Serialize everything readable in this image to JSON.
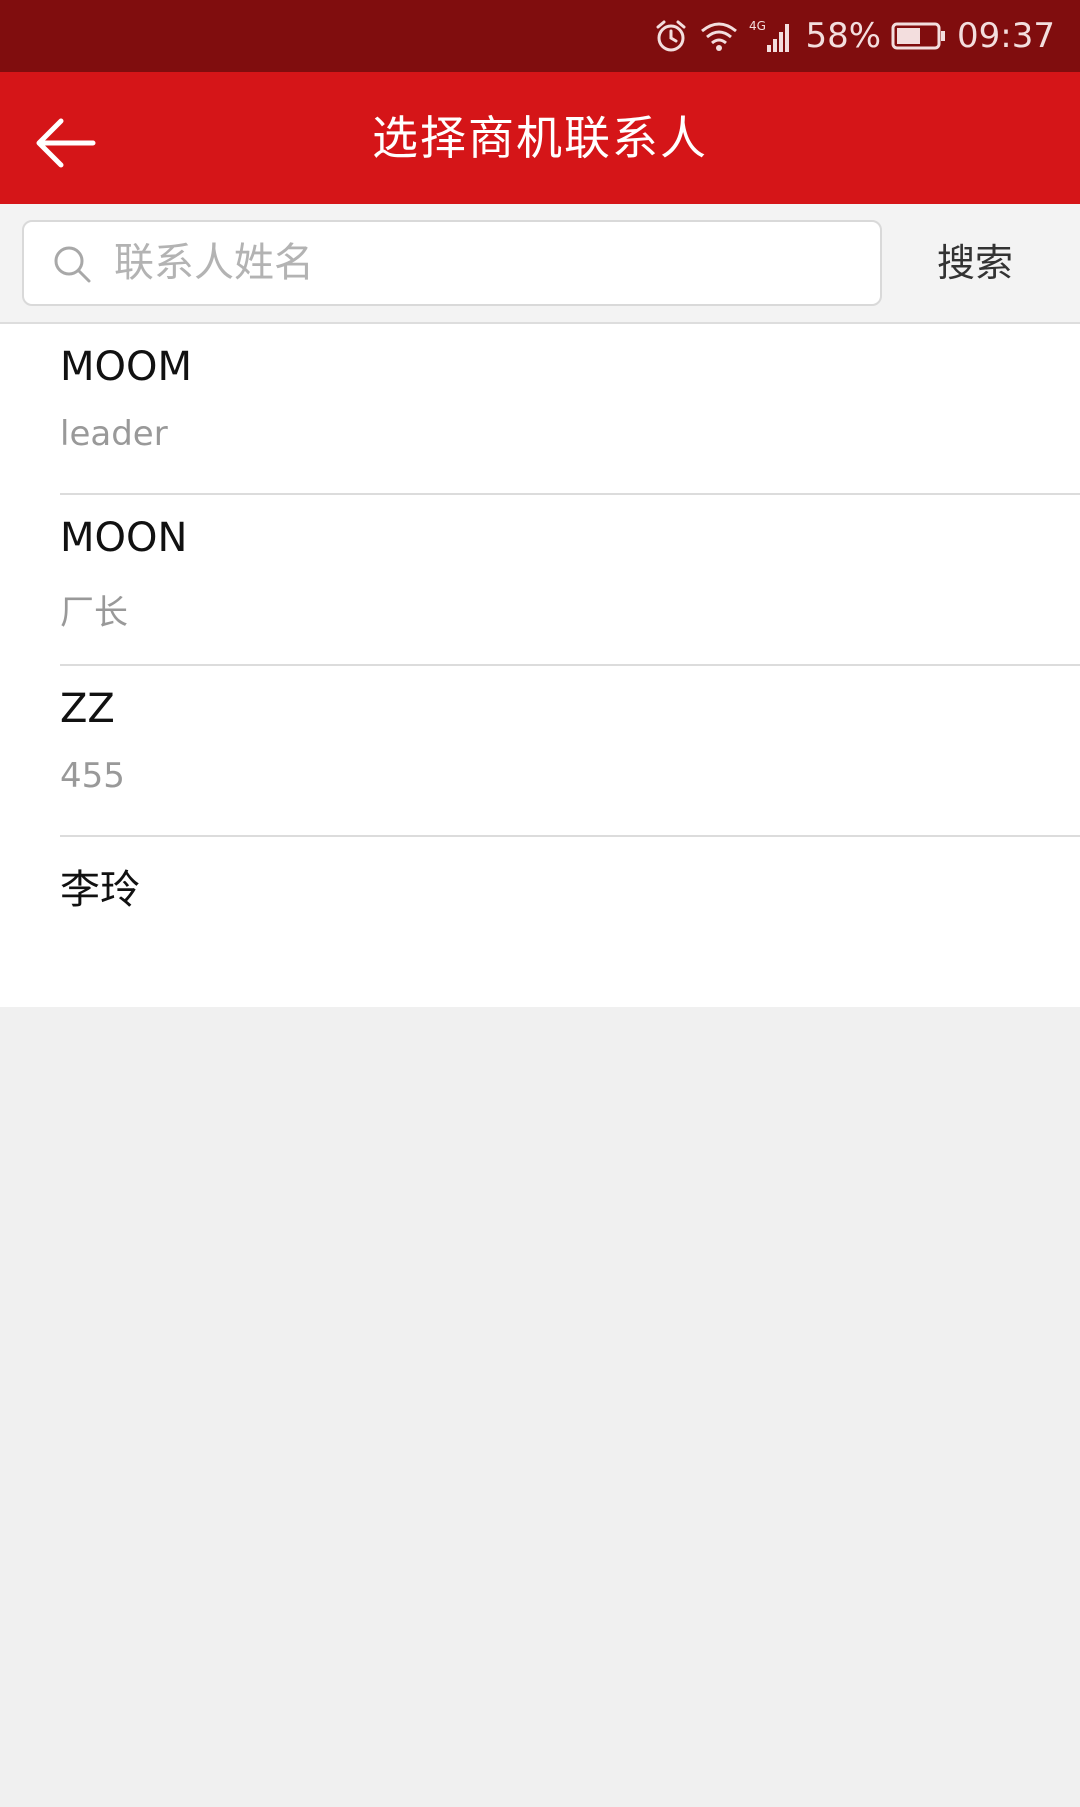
{
  "status_bar": {
    "battery": "58%",
    "time": "09:37",
    "network": "4G",
    "icons": [
      "alarm-icon",
      "wifi-icon",
      "signal-icon",
      "battery-icon"
    ]
  },
  "app_bar": {
    "title": "选择商机联系人",
    "back_icon": "arrow-left-icon",
    "background": "#d51518"
  },
  "search": {
    "placeholder": "联系人姓名",
    "value": "",
    "button_label": "搜索",
    "icon": "search-icon"
  },
  "contacts": [
    {
      "name": "MOOM",
      "title": "leader"
    },
    {
      "name": "MOON",
      "title": "厂长"
    },
    {
      "name": "ZZ",
      "title": "455"
    },
    {
      "name": "李玲",
      "title": ""
    }
  ],
  "colors": {
    "status_bar": "#800d0e",
    "accent": "#d51518",
    "background": "#f0f0f0"
  }
}
